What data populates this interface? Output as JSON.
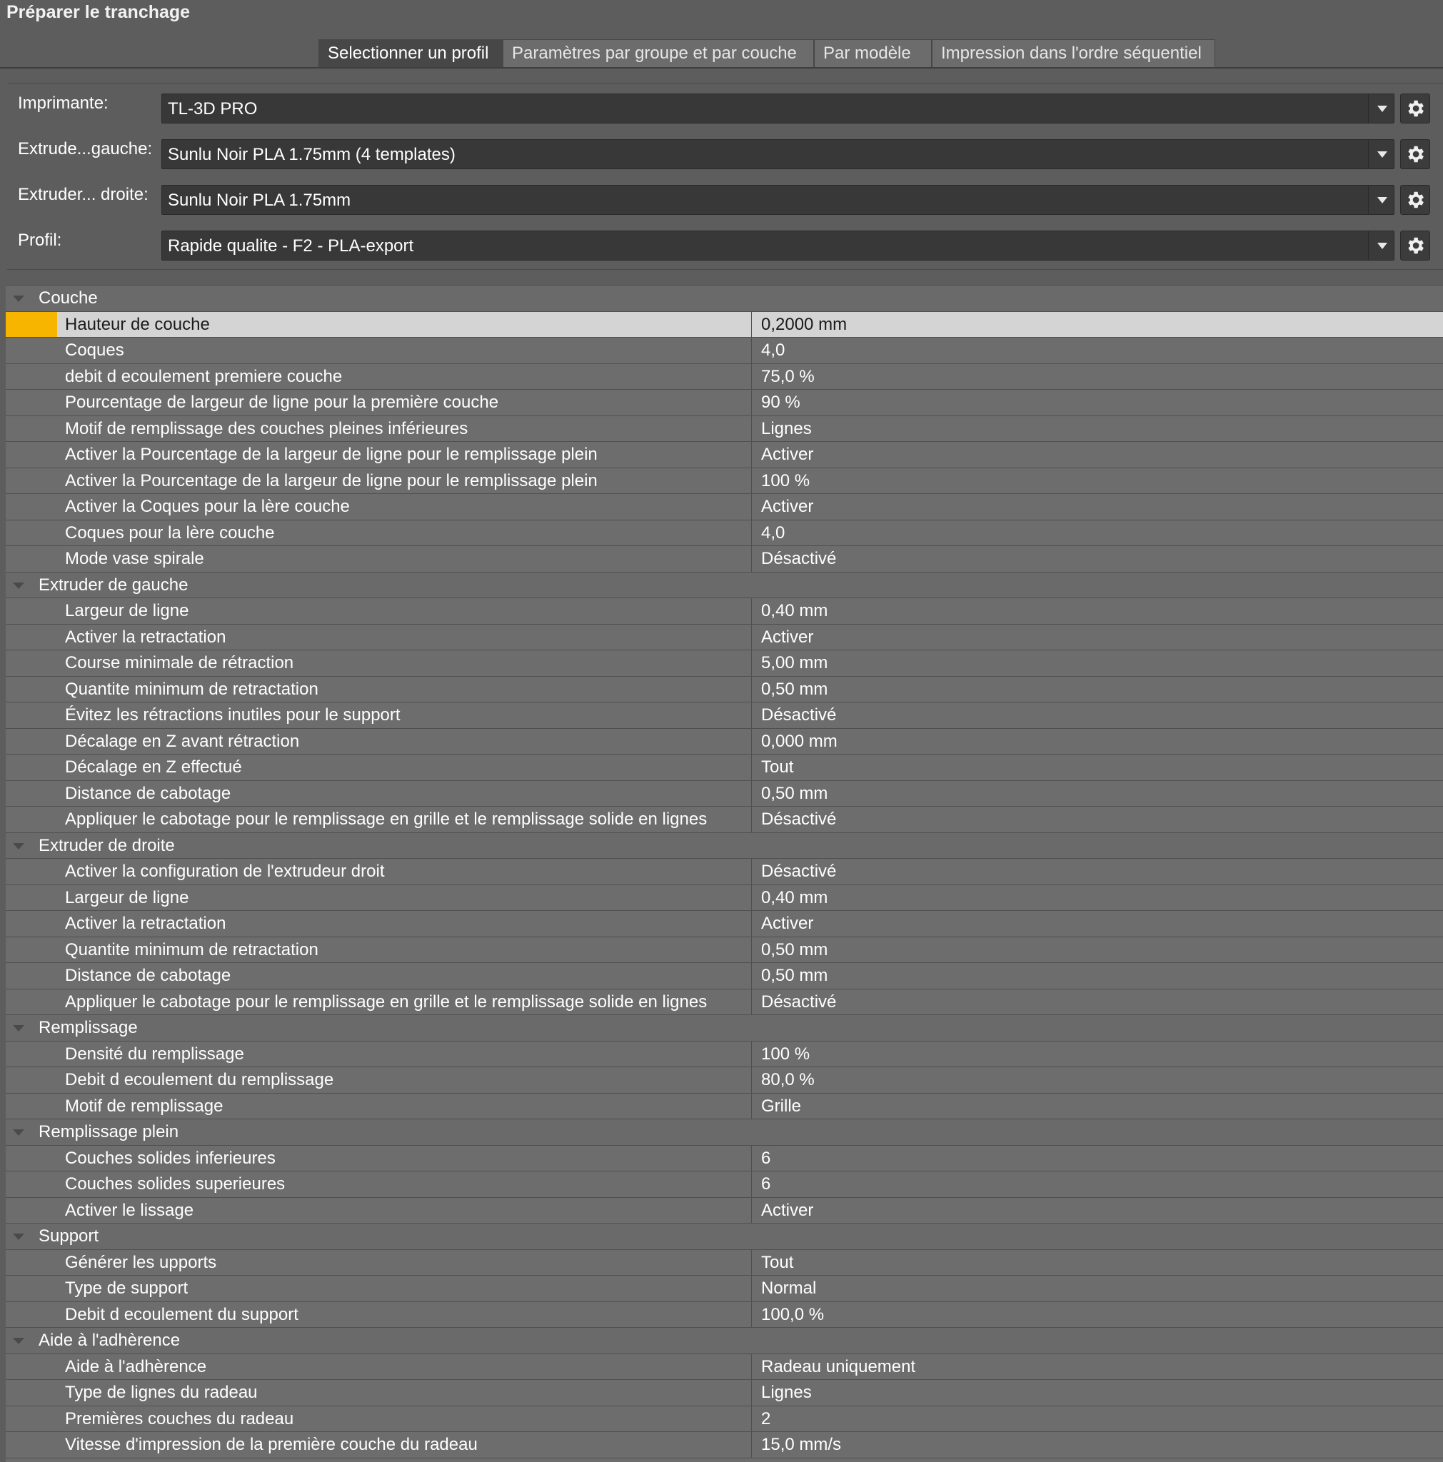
{
  "window": {
    "title": "Préparer le tranchage"
  },
  "tabs": [
    {
      "label": "Selectionner un profil",
      "active": true
    },
    {
      "label": "Paramètres par groupe et par couche",
      "active": false
    },
    {
      "label": "Par modèle",
      "active": false
    },
    {
      "label": "Impression dans l'ordre séquentiel",
      "active": false
    }
  ],
  "profile": {
    "printer": {
      "label": "Imprimante:",
      "value": "TL-3D PRO"
    },
    "extruder_left": {
      "label": "Extrude...gauche:",
      "value": "Sunlu Noir PLA 1.75mm (4 templates)"
    },
    "extruder_right": {
      "label": "Extruder... droite:",
      "value": "Sunlu Noir PLA 1.75mm"
    },
    "profile": {
      "label": "Profil:",
      "value": "Rapide qualite - F2 - PLA-export"
    }
  },
  "colors": {
    "selected_marker": "#f7b500",
    "selected_row": "#d4d4d4"
  },
  "settings": [
    {
      "group": "Couche",
      "items": [
        {
          "name": "Hauteur de couche",
          "value": "0,2000 mm",
          "selected": true
        },
        {
          "name": "Coques",
          "value": "4,0"
        },
        {
          "name": "debit d ecoulement premiere couche",
          "value": "75,0 %"
        },
        {
          "name": "Pourcentage de largeur de ligne pour la première couche",
          "value": "90 %"
        },
        {
          "name": "Motif de remplissage des couches pleines inférieures",
          "value": "Lignes"
        },
        {
          "name": "Activer la Pourcentage de la largeur de ligne pour le remplissage plein",
          "value": "Activer"
        },
        {
          "name": "Activer la Pourcentage de la largeur de ligne pour le remplissage plein",
          "value": "100 %"
        },
        {
          "name": "Activer la Coques pour la lère couche",
          "value": "Activer"
        },
        {
          "name": "Coques pour la lère couche",
          "value": "4,0"
        },
        {
          "name": "Mode vase spirale",
          "value": "Désactivé"
        }
      ]
    },
    {
      "group": "Extruder de gauche",
      "items": [
        {
          "name": "Largeur de ligne",
          "value": "0,40 mm"
        },
        {
          "name": "Activer la retractation",
          "value": "Activer"
        },
        {
          "name": "Course minimale de rétraction",
          "value": "5,00 mm"
        },
        {
          "name": "Quantite minimum de retractation",
          "value": "0,50 mm"
        },
        {
          "name": "Évitez les rétractions inutiles pour le support",
          "value": "Désactivé"
        },
        {
          "name": "Décalage en Z avant rétraction",
          "value": "0,000 mm"
        },
        {
          "name": "Décalage en Z effectué",
          "value": "Tout"
        },
        {
          "name": "Distance de cabotage",
          "value": "0,50 mm"
        },
        {
          "name": "Appliquer le cabotage pour le remplissage en grille et le remplissage solide en lignes",
          "value": "Désactivé"
        }
      ]
    },
    {
      "group": "Extruder de droite",
      "items": [
        {
          "name": "Activer la configuration de l'extrudeur droit",
          "value": "Désactivé"
        },
        {
          "name": "Largeur de ligne",
          "value": "0,40 mm"
        },
        {
          "name": "Activer la retractation",
          "value": "Activer"
        },
        {
          "name": "Quantite minimum de retractation",
          "value": "0,50 mm"
        },
        {
          "name": "Distance de cabotage",
          "value": "0,50 mm"
        },
        {
          "name": "Appliquer le cabotage pour le remplissage en grille et le remplissage solide en lignes",
          "value": "Désactivé"
        }
      ]
    },
    {
      "group": "Remplissage",
      "items": [
        {
          "name": "Densité du remplissage",
          "value": "100 %"
        },
        {
          "name": "Debit d ecoulement du remplissage",
          "value": "80,0 %"
        },
        {
          "name": "Motif de remplissage",
          "value": "Grille"
        }
      ]
    },
    {
      "group": "Remplissage plein",
      "items": [
        {
          "name": "Couches solides inferieures",
          "value": "6"
        },
        {
          "name": "Couches solides superieures",
          "value": "6"
        },
        {
          "name": "Activer le lissage",
          "value": "Activer"
        }
      ]
    },
    {
      "group": "Support",
      "items": [
        {
          "name": "Générer les upports",
          "value": "Tout"
        },
        {
          "name": "Type de support",
          "value": "Normal"
        },
        {
          "name": "Debit d ecoulement du support",
          "value": "100,0 %"
        }
      ]
    },
    {
      "group": "Aide à l'adhèrence",
      "items": [
        {
          "name": "Aide à l'adhèrence",
          "value": "Radeau uniquement"
        },
        {
          "name": "Type de lignes du radeau",
          "value": "Lignes"
        },
        {
          "name": "Premières couches du radeau",
          "value": "2"
        },
        {
          "name": "Vitesse d'impression de la première couche du radeau",
          "value": "15,0 mm/s"
        }
      ]
    }
  ]
}
